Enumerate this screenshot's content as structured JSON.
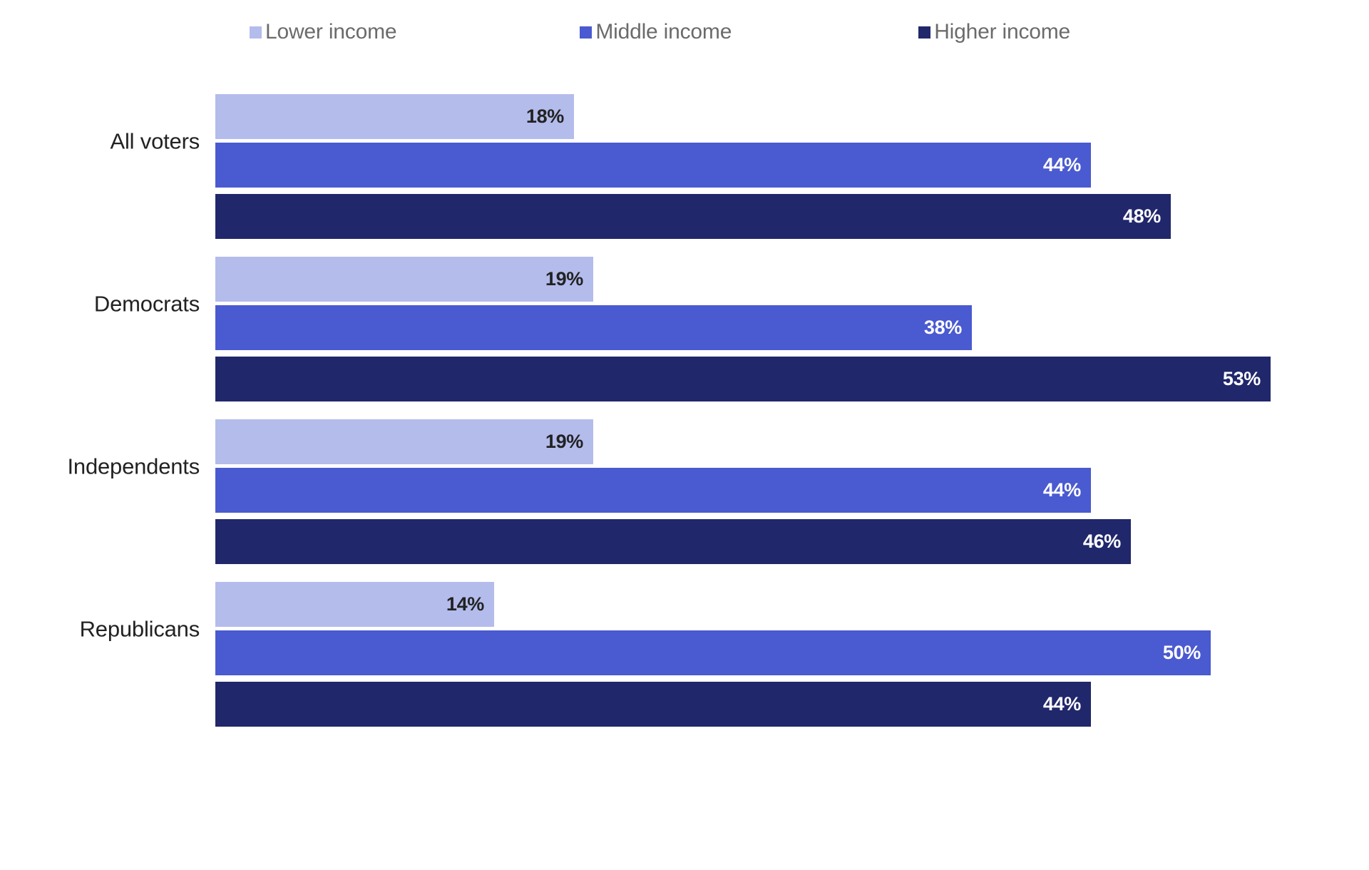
{
  "legend": {
    "items": [
      {
        "label": "Lower income",
        "color": "#b4bcec",
        "icon": "legend-square-icon"
      },
      {
        "label": "Middle income",
        "color": "#4a5ad0",
        "icon": "legend-square-icon"
      },
      {
        "label": "Higher income",
        "color": "#21276b",
        "icon": "legend-square-icon"
      }
    ]
  },
  "chart_data": {
    "type": "bar",
    "orientation": "horizontal",
    "title": "",
    "subtitle": "",
    "xlabel": "",
    "ylabel": "",
    "grid": false,
    "legend_position": "top",
    "xlim": [
      0,
      58
    ],
    "value_suffix": "%",
    "categories": [
      "All voters",
      "Democrats",
      "Independents",
      "Republicans"
    ],
    "series": [
      {
        "name": "Lower income",
        "color": "#b4bcec",
        "label_color": "#222222",
        "values": [
          18,
          19,
          19,
          14
        ],
        "labels": [
          "18%",
          "19%",
          "19%",
          "14%"
        ]
      },
      {
        "name": "Middle income",
        "color": "#4a5ad0",
        "label_color": "#ffffff",
        "values": [
          44,
          38,
          44,
          50
        ],
        "labels": [
          "44%",
          "38%",
          "44%",
          "50%"
        ]
      },
      {
        "name": "Higher income",
        "color": "#21276b",
        "label_color": "#ffffff",
        "values": [
          48,
          53,
          46,
          44
        ],
        "labels": [
          "48%",
          "53%",
          "46%",
          "44%"
        ]
      }
    ]
  }
}
